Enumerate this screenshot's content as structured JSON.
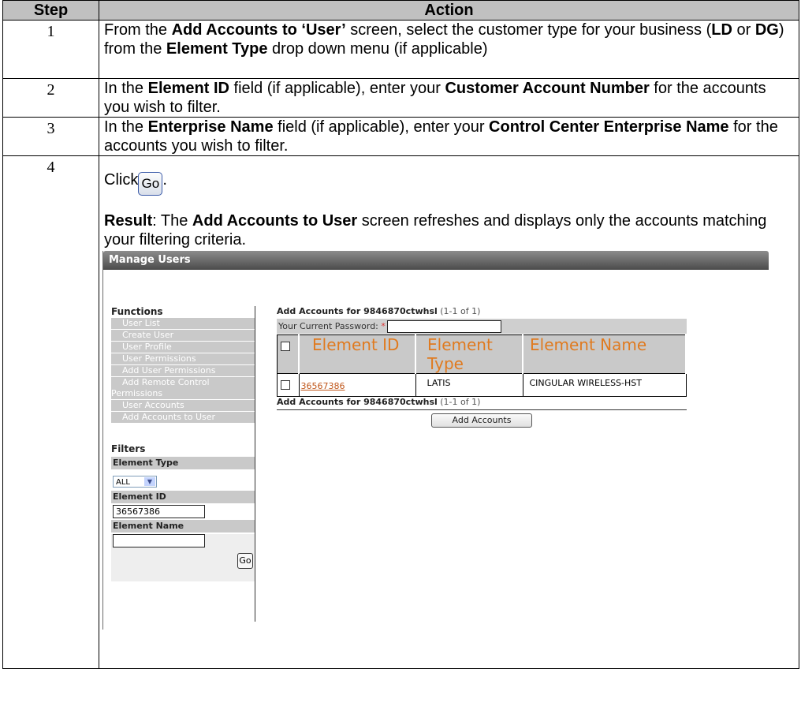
{
  "table": {
    "headers": {
      "step": "Step",
      "action": "Action"
    },
    "rows": [
      {
        "step": "1",
        "t1": "From the ",
        "b1": "Add Accounts to ‘User’",
        "t2": " screen, select the customer type for your business (",
        "b2": "LD",
        "t3": " or ",
        "b3": "DG",
        "t4": ") from the ",
        "b4": "Element Type",
        "t5": " drop down menu (if applicable)"
      },
      {
        "step": "2",
        "t1": "In the ",
        "b1": "Element ID",
        "t2": " field (if applicable), enter your ",
        "b2": "Customer Account Number",
        "t3": " for the accounts you wish to filter."
      },
      {
        "step": "3",
        "t1": "In the ",
        "b1": "Enterprise Name",
        "t2": " field (if applicable), enter your ",
        "b2": "Control Center Enterprise Name",
        "t3": " for the accounts you wish to filter."
      },
      {
        "step": "4",
        "click": "Click",
        "go": "Go",
        "period": ".",
        "result_label": "Result",
        "r1": ":  The ",
        "rb": "Add Accounts to User",
        "r2": " screen refreshes and displays only the accounts matching your filtering criteria."
      }
    ]
  },
  "screenshot": {
    "title": "Manage Users",
    "functions_heading": "Functions",
    "functions": [
      "User List",
      "Create User",
      "User Profile",
      "User Permissions",
      "Add User Permissions",
      "Add Remote Control Permissions",
      "User Accounts",
      "Add Accounts to User"
    ],
    "filters_heading": "Filters",
    "element_type_label": "Element Type",
    "element_type_value": "ALL",
    "element_id_label": "Element ID",
    "element_id_value": "36567386",
    "element_name_label": "Element Name",
    "element_name_value": "",
    "go_label": "Go",
    "add_header_prefix": "Add Accounts for 9846870ctwhsl",
    "add_header_count": "(1-1 of 1)",
    "password_label": "Your Current Password:",
    "required_mark": "*",
    "columns": [
      "Element ID",
      "Element Type",
      "Element Name"
    ],
    "rows": [
      {
        "id": "36567386",
        "type": "LATIS",
        "name": "CINGULAR WIRELESS-HST"
      }
    ],
    "add_button": "Add Accounts"
  }
}
